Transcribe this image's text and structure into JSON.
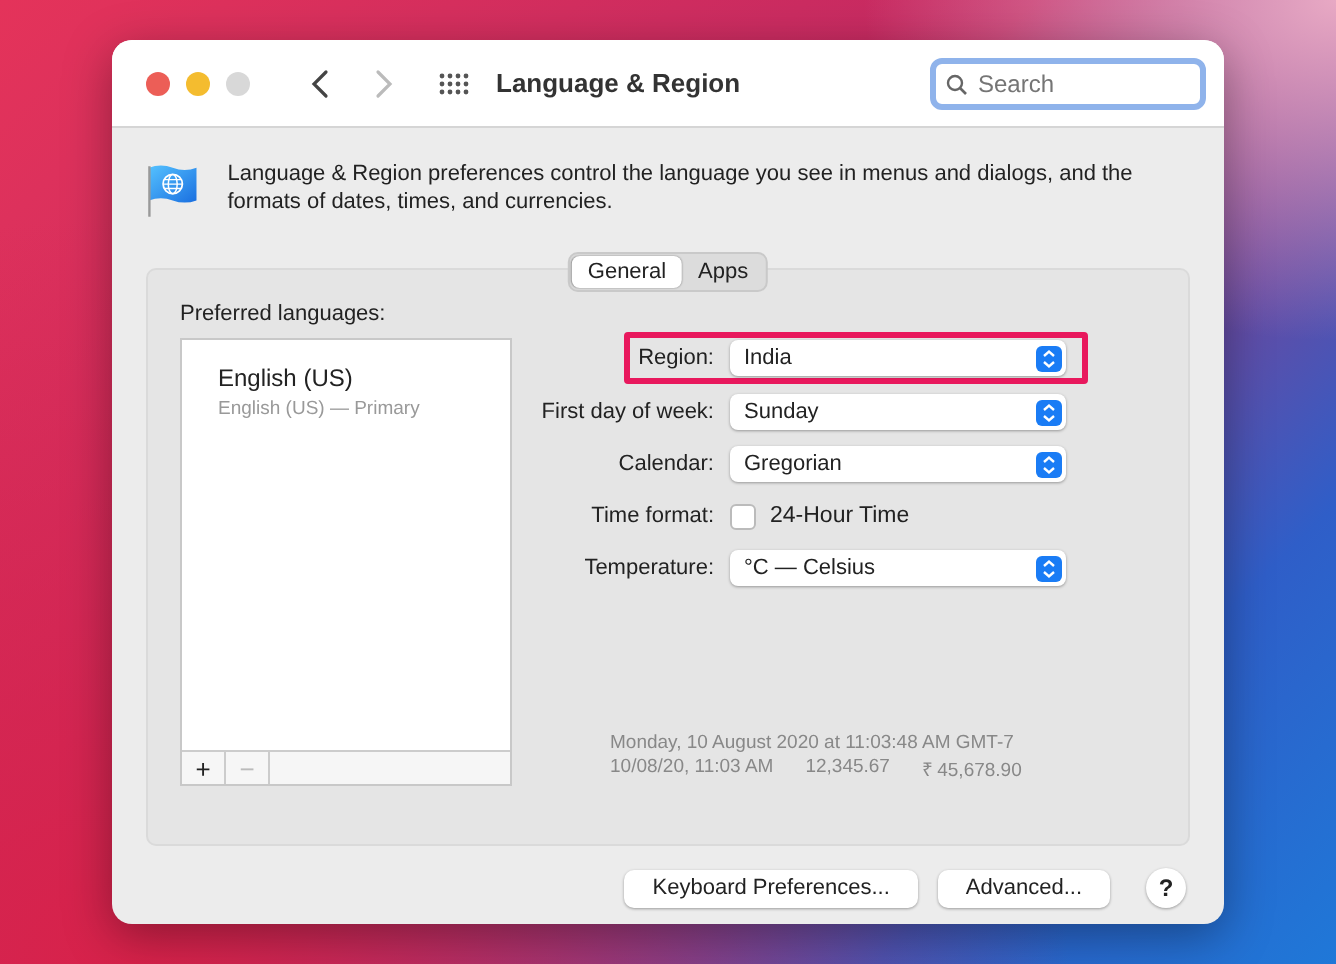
{
  "window": {
    "title": "Language & Region"
  },
  "navigation": [
    {
      "kind": "back",
      "disabled": false
    },
    {
      "kind": "forward",
      "disabled": true
    }
  ],
  "search": {
    "placeholder": "Search",
    "focused": true
  },
  "description": "Language & Region preferences control the language you see in menus and dialogs, and the formats of dates, times, and currencies.",
  "tabs": [
    {
      "label": "General",
      "selected": true
    },
    {
      "label": "Apps",
      "selected": false
    }
  ],
  "preferred_languages": {
    "label": "Preferred languages:",
    "items": [
      {
        "name": "English (US)",
        "detail": "English (US) — Primary"
      }
    ],
    "buttons": [
      {
        "label": "+",
        "disabled": false
      },
      {
        "label": "−",
        "disabled": true
      }
    ]
  },
  "settings": [
    {
      "kind": "popup",
      "label": "Region:",
      "value": "India",
      "highlighted": true
    },
    {
      "kind": "popup",
      "label": "First day of week:",
      "value": "Sunday",
      "highlighted": false
    },
    {
      "kind": "popup",
      "label": "Calendar:",
      "value": "Gregorian",
      "highlighted": false
    },
    {
      "kind": "checkbox",
      "label": "Time format:",
      "value": "24-Hour Time",
      "checked": false,
      "highlighted": false
    },
    {
      "kind": "popup",
      "label": "Temperature:",
      "value": "°C — Celsius",
      "highlighted": false
    }
  ],
  "sample": {
    "line_1": "Monday, 10 August 2020 at 11:03:48 AM GMT-7",
    "line_2": [
      "10/08/20, 11:03 AM",
      "12,345.67",
      "₹ 45,678.90"
    ]
  },
  "buttons": [
    "Keyboard Preferences...",
    "Advanced..."
  ],
  "help": "?"
}
